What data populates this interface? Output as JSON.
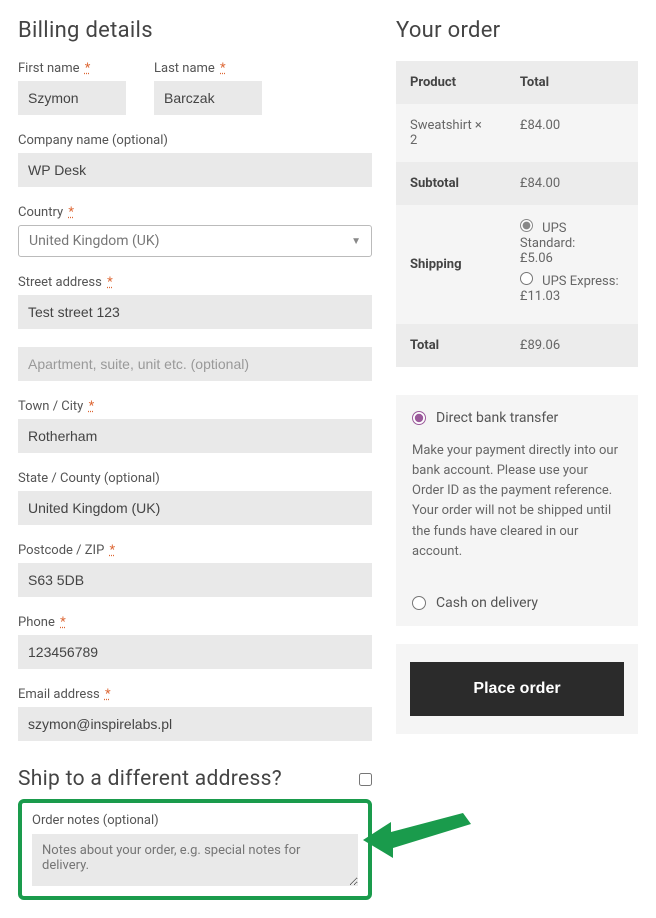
{
  "billing": {
    "heading": "Billing details",
    "first_name": {
      "label": "First name",
      "value": "Szymon",
      "required": "*"
    },
    "last_name": {
      "label": "Last name",
      "value": "Barczak",
      "required": "*"
    },
    "company": {
      "label": "Company name (optional)",
      "value": "WP Desk"
    },
    "country": {
      "label": "Country",
      "value": "United Kingdom (UK)",
      "required": "*"
    },
    "street": {
      "label": "Street address",
      "value": "Test street 123",
      "required": "*"
    },
    "street2": {
      "placeholder": "Apartment, suite, unit etc. (optional)"
    },
    "city": {
      "label": "Town / City",
      "value": "Rotherham",
      "required": "*"
    },
    "state": {
      "label": "State / County (optional)",
      "value": "United Kingdom (UK)"
    },
    "postcode": {
      "label": "Postcode / ZIP",
      "value": "S63 5DB",
      "required": "*"
    },
    "phone": {
      "label": "Phone",
      "value": "123456789",
      "required": "*"
    },
    "email": {
      "label": "Email address",
      "value": "szymon@inspirelabs.pl",
      "required": "*"
    }
  },
  "shipping": {
    "heading": "Ship to a different address?",
    "notes_label": "Order notes (optional)",
    "notes_placeholder": "Notes about your order, e.g. special notes for delivery."
  },
  "order": {
    "heading": "Your order",
    "header_product": "Product",
    "header_total": "Total",
    "line_item": {
      "name": "Sweatshirt  × 2",
      "total": "£84.00"
    },
    "subtotal_label": "Subtotal",
    "subtotal_value": "£84.00",
    "shipping_label": "Shipping",
    "ship_opts": [
      {
        "label": "UPS Standard:",
        "price": "£5.06",
        "checked": true
      },
      {
        "label": "UPS Express:",
        "price": "£11.03",
        "checked": false
      }
    ],
    "total_label": "Total",
    "total_value": "£89.06"
  },
  "payment": {
    "opts": [
      {
        "label": "Direct bank transfer",
        "checked": true,
        "desc": "Make your payment directly into our bank account. Please use your Order ID as the payment reference. Your order will not be shipped until the funds have cleared in our account."
      },
      {
        "label": "Cash on delivery",
        "checked": false
      }
    ],
    "button": "Place order"
  }
}
